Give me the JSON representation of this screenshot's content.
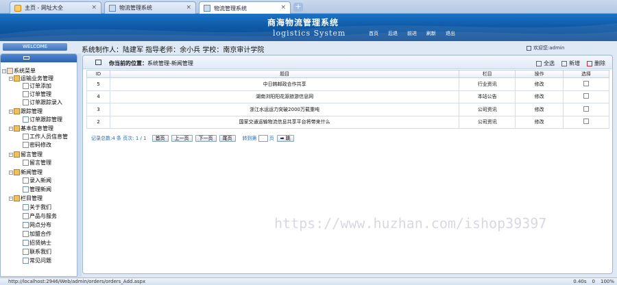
{
  "browser": {
    "tabs": [
      {
        "label": "主页 - 网址大全"
      },
      {
        "label": "物流管理系统"
      },
      {
        "label": "物流管理系统"
      }
    ],
    "status_url": "http://localhost:2946/Web/admin/orders/orders_Add.aspx",
    "status_time": "0.40s",
    "status_count": "0",
    "status_zoom": "100%"
  },
  "header": {
    "title": "商海物流管理系统",
    "subtitle": "logistics System",
    "nav": [
      "首页",
      "后退",
      "前进",
      "刷新",
      "退出"
    ]
  },
  "left": {
    "welcome": "WELCOME",
    "tree": [
      {
        "label": "系统菜单"
      },
      {
        "label": "运输业务管理"
      },
      {
        "label": "订单添加"
      },
      {
        "label": "订单管理"
      },
      {
        "label": "订单跟踪录入"
      },
      {
        "label": "跟踪管理"
      },
      {
        "label": "订单跟踪管理"
      },
      {
        "label": "基本信息管理"
      },
      {
        "label": "工作人员信息管"
      },
      {
        "label": "密码修改"
      },
      {
        "label": "留言管理"
      },
      {
        "label": "留言管理"
      },
      {
        "label": "新闻管理"
      },
      {
        "label": "录入新闻"
      },
      {
        "label": "管理新闻"
      },
      {
        "label": "栏目管理"
      },
      {
        "label": "关于我们"
      },
      {
        "label": "产品与服务"
      },
      {
        "label": "网点分布"
      },
      {
        "label": "加盟合作"
      },
      {
        "label": "招贤纳士"
      },
      {
        "label": "联系我们"
      },
      {
        "label": "常见问题"
      }
    ]
  },
  "content": {
    "credit": "系统制作人：陆建军 指导老师：余小兵 学校：南京审计学院",
    "welcome_user": "欢迎您:admin",
    "location_label": "你当前的位置：",
    "location_value": "系统管理-新闻管理",
    "actions": {
      "select_all": "全选",
      "add": "新增",
      "delete": "删除"
    },
    "columns": [
      "ID",
      "题目",
      "栏目",
      "操作",
      "选择"
    ],
    "rows": [
      {
        "id": "5",
        "title": "中日韩邮政合作共享",
        "category": "行业资讯",
        "op": "修改"
      },
      {
        "id": "4",
        "title": "湖南浏阳阳花源旅游信息网",
        "category": "本站公告",
        "op": "修改"
      },
      {
        "id": "3",
        "title": "浙江水运运力突破2000万载重吨",
        "category": "公司资讯",
        "op": "修改"
      },
      {
        "id": "2",
        "title": "国家交通运输物流信息共享平台将带来什么",
        "category": "公司资讯",
        "op": "修改"
      }
    ],
    "pager": {
      "summary": "记录总数:4 条  页次: 1 / 1",
      "first": "首页",
      "prev": "上一页",
      "next": "下一页",
      "last": "尾页",
      "goto": "转到第",
      "page_unit": "页",
      "go": "跳"
    }
  },
  "watermark": "https://www.huzhan.com/ishop39397"
}
